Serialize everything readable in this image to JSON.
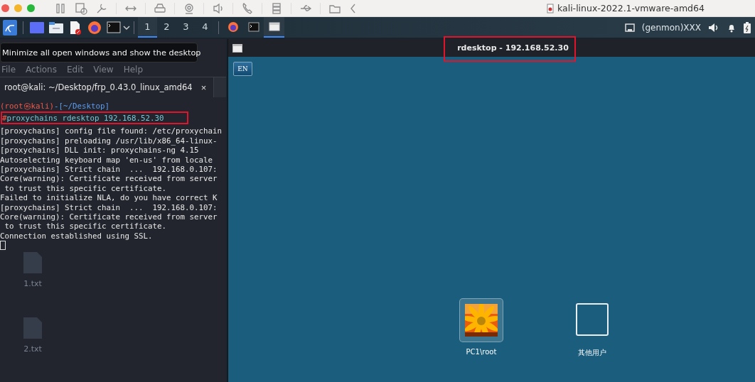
{
  "vm_toolbar": {
    "title": "kali-linux-2022.1-vmware-amd64"
  },
  "panel": {
    "workspaces": [
      {
        "label": "1",
        "selected": true
      },
      {
        "label": "2",
        "selected": false
      },
      {
        "label": "3",
        "selected": false
      },
      {
        "label": "4",
        "selected": false
      }
    ],
    "tasks": [
      {
        "kind": "firefox",
        "selected": false
      },
      {
        "kind": "terminal",
        "selected": false
      },
      {
        "kind": "window",
        "selected": true
      }
    ],
    "genmon": "(genmon)XXX"
  },
  "tooltip": "Minimize all open windows and show the desktop",
  "terminal": {
    "menu": [
      "File",
      "Actions",
      "Edit",
      "View",
      "Help"
    ],
    "tab": "root@kali: ~/Desktop/frp_0.43.0_linux_amd64",
    "tab_close": "×",
    "prompt_user": "(root㉿kali)",
    "prompt_dir": "-[~/Desktop]",
    "prompt_mark": "#",
    "command": "proxychains rdesktop 192.168.52.30",
    "lines": [
      "[proxychains] config file found: /etc/proxychain",
      "[proxychains] preloading /usr/lib/x86_64-linux-",
      "[proxychains] DLL init: proxychains-ng 4.15",
      "Autoselecting keyboard map 'en-us' from locale",
      "[proxychains] Strict chain  ...  192.168.0.107:",
      "Core(warning): Certificate received from server",
      " to trust this specific certificate.",
      "Failed to initialize NLA, do you have correct K",
      "[proxychains] Strict chain  ...  192.168.0.107:",
      "Core(warning): Certificate received from server",
      " to trust this specific certificate.",
      "Connection established using SSL."
    ]
  },
  "desktop_files": [
    "1.txt",
    "2.txt"
  ],
  "rdesktop": {
    "title": "rdesktop - 192.168.52.30",
    "language": "EN",
    "users": [
      {
        "name": "PC1\\root",
        "kind": "picture"
      },
      {
        "name": "其他用户",
        "kind": "blank"
      }
    ]
  }
}
